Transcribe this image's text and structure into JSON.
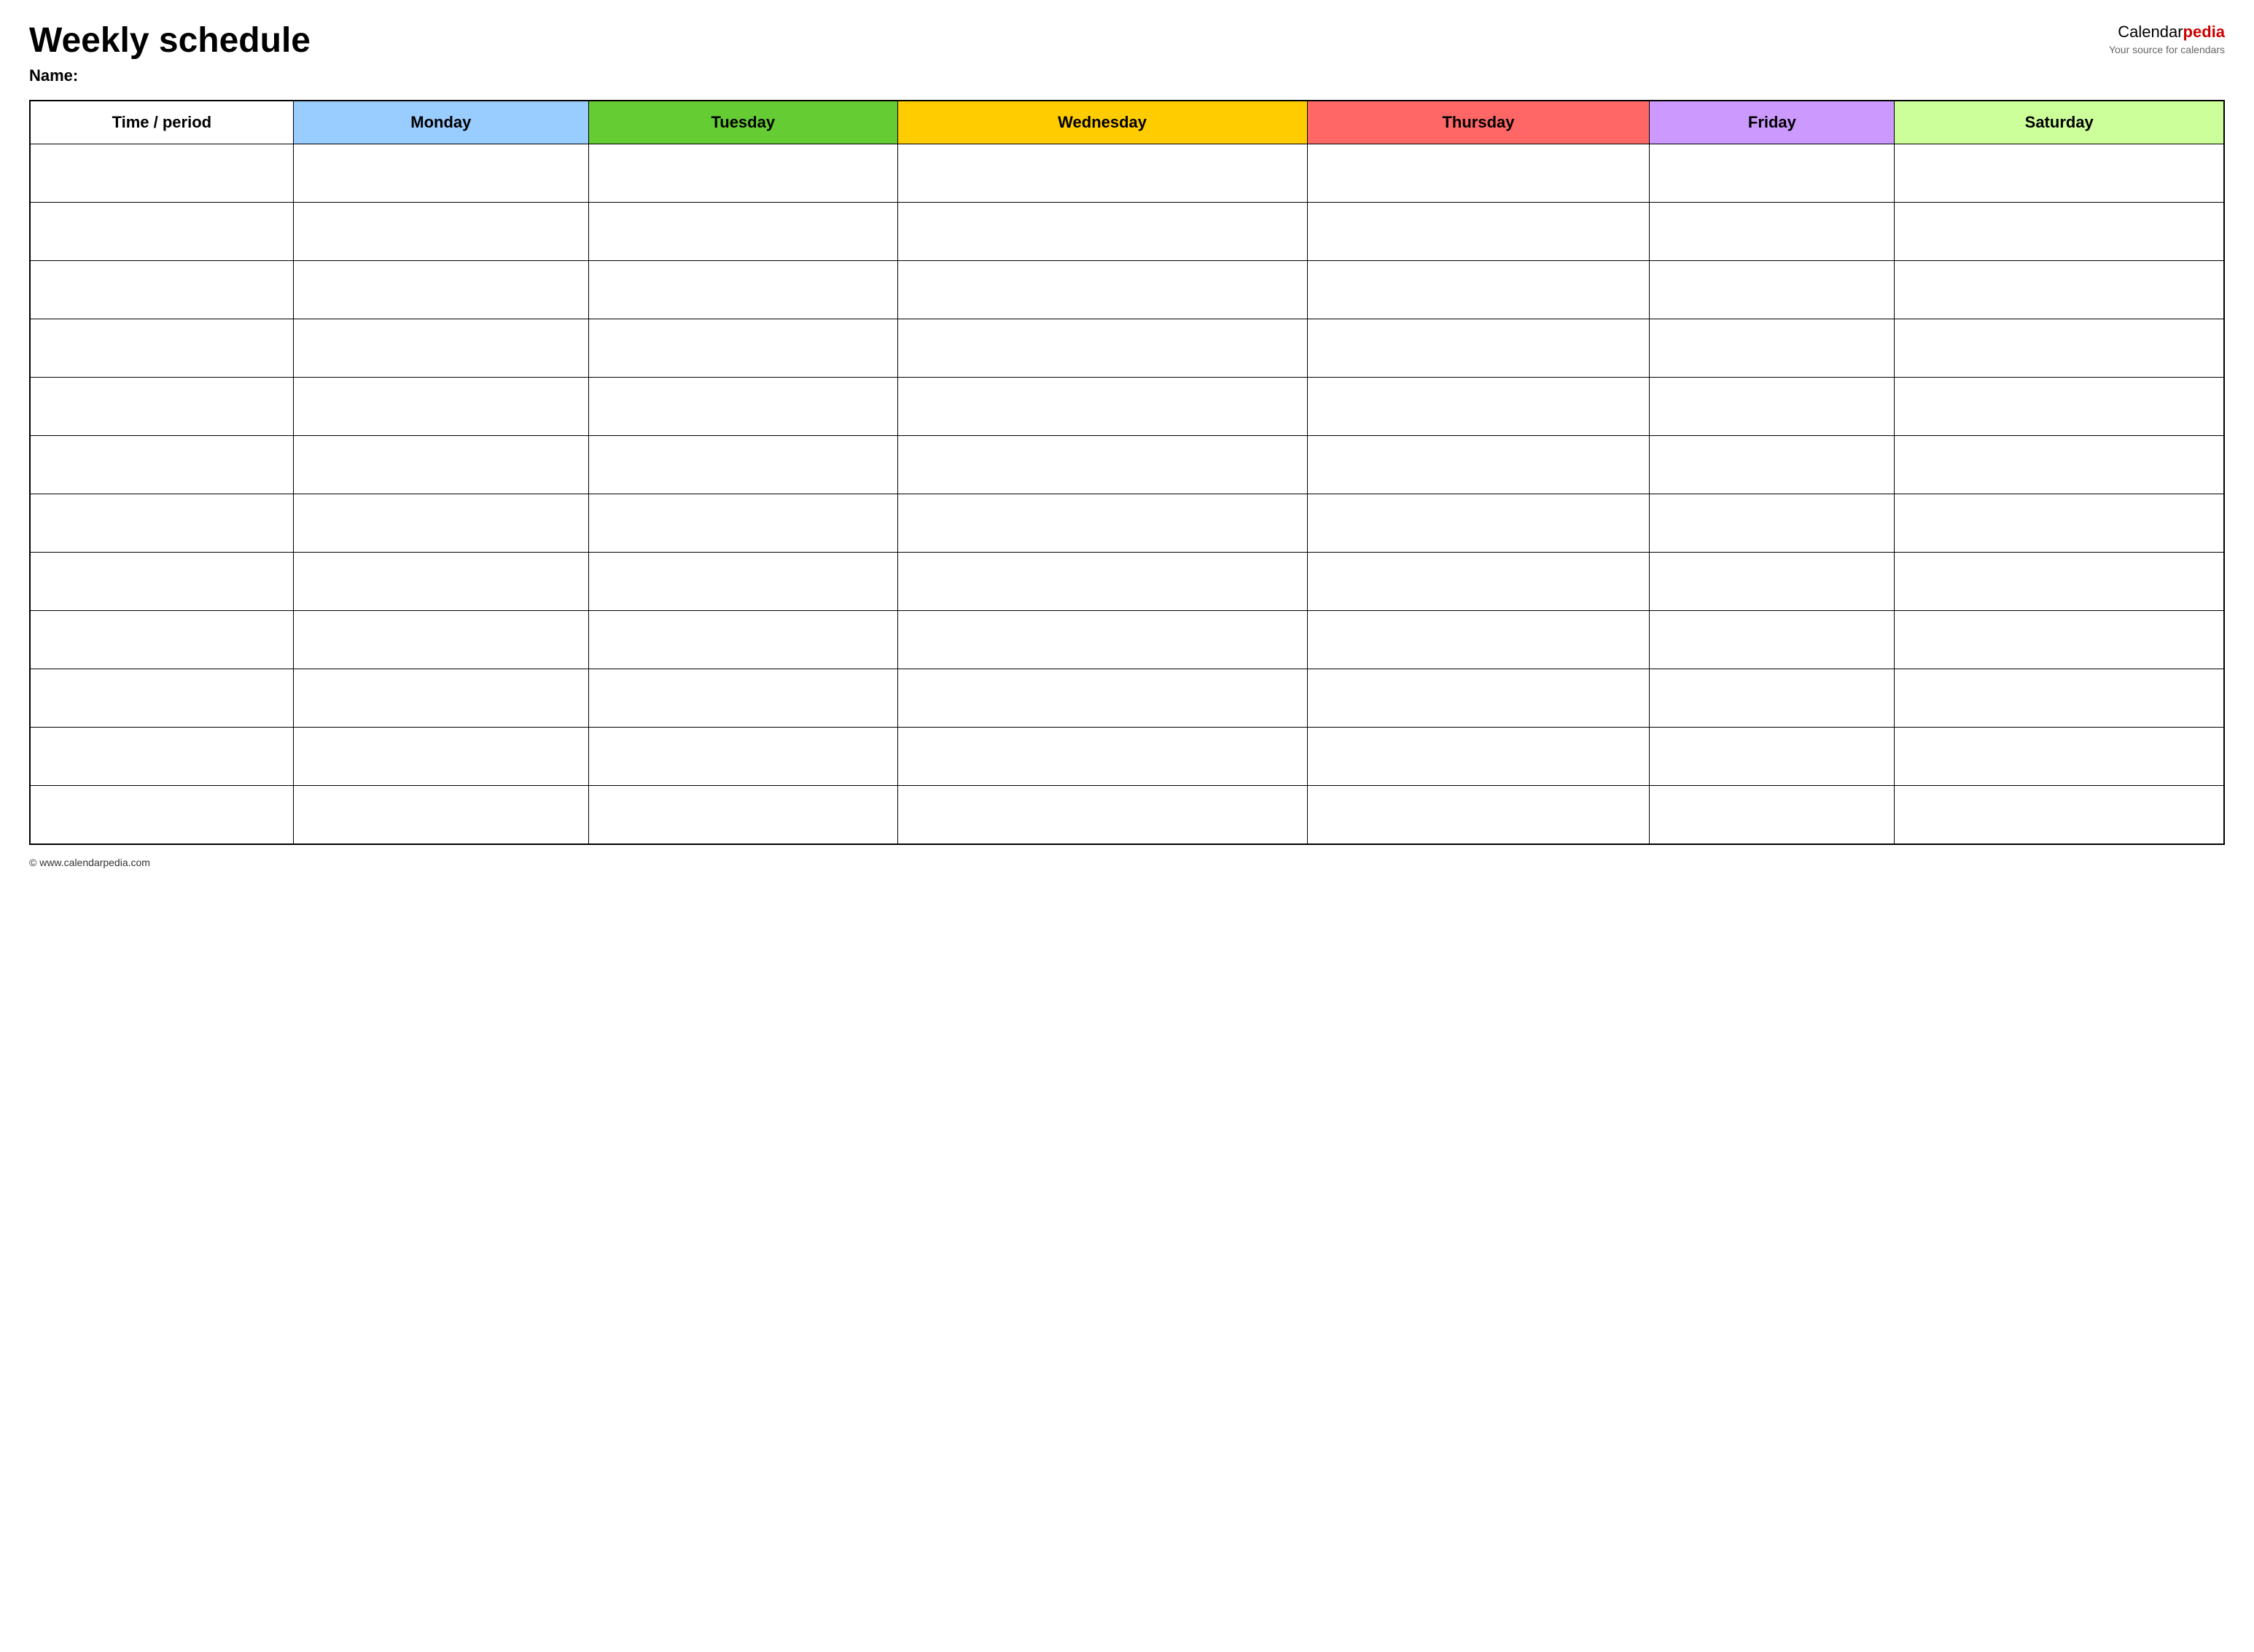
{
  "header": {
    "title": "Weekly schedule",
    "name_label": "Name:",
    "logo_calendar": "Calendar",
    "logo_pedia": "pedia",
    "logo_tagline": "Your source for calendars"
  },
  "table": {
    "columns": [
      {
        "key": "time",
        "label": "Time / period",
        "color_class": "col-time"
      },
      {
        "key": "monday",
        "label": "Monday",
        "color_class": "col-monday"
      },
      {
        "key": "tuesday",
        "label": "Tuesday",
        "color_class": "col-tuesday"
      },
      {
        "key": "wednesday",
        "label": "Wednesday",
        "color_class": "col-wednesday"
      },
      {
        "key": "thursday",
        "label": "Thursday",
        "color_class": "col-thursday"
      },
      {
        "key": "friday",
        "label": "Friday",
        "color_class": "col-friday"
      },
      {
        "key": "saturday",
        "label": "Saturday",
        "color_class": "col-saturday"
      }
    ],
    "row_count": 12
  },
  "footer": {
    "url": "© www.calendarpedia.com"
  }
}
